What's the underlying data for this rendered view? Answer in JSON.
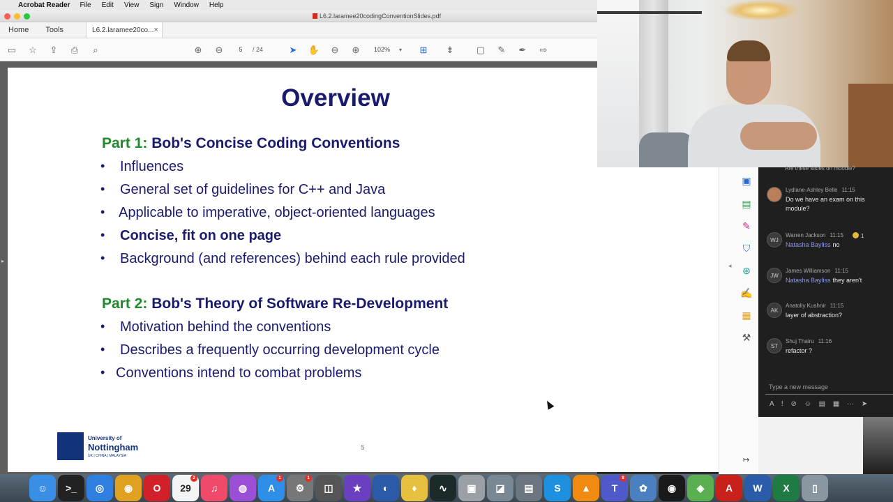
{
  "menubar": {
    "apple": "",
    "app_name": "Acrobat Reader",
    "items": [
      "File",
      "Edit",
      "View",
      "Sign",
      "Window",
      "Help"
    ]
  },
  "window": {
    "title": "L6.2.laramee20codingConventionSlides.pdf"
  },
  "tabs": {
    "home": "Home",
    "tools": "Tools",
    "doc_tab": "L6.2.laramee20co...",
    "close": "×"
  },
  "toolbar": {
    "icons": [
      "save-icon",
      "star-icon",
      "upload-icon",
      "print-icon",
      "zoom-search-icon",
      "page-up-icon",
      "page-down-icon",
      "select-arrow-icon",
      "hand-icon",
      "zoom-out-icon",
      "zoom-in-icon",
      "fit-page-icon",
      "scroll-icon",
      "comment-icon",
      "pen-icon",
      "sign-icon",
      "more-tools-icon"
    ],
    "page_current": "5",
    "page_total": "/ 24",
    "zoom_level": "102%"
  },
  "slide": {
    "title": "Overview",
    "part1": {
      "label": "Part 1:",
      "title": "Bob's Concise Coding Conventions",
      "bullets": [
        "Influences",
        "General set of guidelines for C++ and Java",
        "Applicable to imperative, object-oriented languages",
        "Concise, fit on one page",
        "Background (and references) behind each rule provided"
      ]
    },
    "part2": {
      "label": "Part 2:",
      "title": "Bob's Theory of Software Re-Development",
      "bullets": [
        "Motivation behind the conventions",
        "Describes a frequently occurring development cycle",
        "Conventions intend to combat problems"
      ]
    },
    "bullet_char": "•",
    "page_number": "5",
    "logo": {
      "line1": "University of",
      "line2": "Nottingham",
      "line3": "UK | CHINA | MALAYSIA"
    }
  },
  "chat": {
    "cut_message": "Are these slides on moodle?",
    "messages": [
      {
        "author": "Lydiane-Ashley Belle",
        "time": "11:15",
        "initials": "",
        "mention": "",
        "text": "Do we have an exam on this module?"
      },
      {
        "author": "Warren Jackson",
        "time": "11:15",
        "initials": "WJ",
        "mention": "Natasha Bayliss",
        "text": "no",
        "reaction": "1"
      },
      {
        "author": "James Williamson",
        "time": "11:15",
        "initials": "JW",
        "mention": "Natasha Bayliss",
        "text": "they aren't"
      },
      {
        "author": "Anatoliy Kushnir",
        "time": "11:15",
        "initials": "AK",
        "mention": "",
        "text": "layer of abstraction?"
      },
      {
        "author": "Shuj Thairu",
        "time": "11:16",
        "initials": "ST",
        "mention": "",
        "text": "refactor ?"
      }
    ],
    "compose_placeholder": "Type a new message",
    "compose_tools": "A ! ⊘ ☺ ▤ ▦ ··· ➤"
  },
  "dock": {
    "apps": [
      {
        "name": "finder",
        "glyph": "☺",
        "color": "#3a8ee6"
      },
      {
        "name": "terminal",
        "glyph": ">_",
        "color": "#222222"
      },
      {
        "name": "safari",
        "glyph": "◎",
        "color": "#2f7fe0"
      },
      {
        "name": "chrome",
        "glyph": "◉",
        "color": "#e0a020"
      },
      {
        "name": "opera",
        "glyph": "O",
        "color": "#d0202a"
      },
      {
        "name": "calendar",
        "glyph": "29",
        "color": "#f4f4f4",
        "badge": "2"
      },
      {
        "name": "music",
        "glyph": "♫",
        "color": "#f04a6a"
      },
      {
        "name": "podcasts",
        "glyph": "◍",
        "color": "#9b4fd6"
      },
      {
        "name": "app-store",
        "glyph": "A",
        "color": "#2f8ee8",
        "badge": "1"
      },
      {
        "name": "system-preferences",
        "glyph": "⚙",
        "color": "#777777",
        "badge": "1"
      },
      {
        "name": "screenshot",
        "glyph": "◫",
        "color": "#555555"
      },
      {
        "name": "imovie",
        "glyph": "★",
        "color": "#6a3fc0"
      },
      {
        "name": "network",
        "glyph": "◐",
        "color": "#2a5aa8"
      },
      {
        "name": "cyberduck",
        "glyph": "♦",
        "color": "#e8c040"
      },
      {
        "name": "activity-monitor",
        "glyph": "∿",
        "color": "#1c2a2a"
      },
      {
        "name": "disk-utility",
        "glyph": "▣",
        "color": "#9aa0a6"
      },
      {
        "name": "preview",
        "glyph": "◪",
        "color": "#7a8894"
      },
      {
        "name": "printer",
        "glyph": "▤",
        "color": "#6b7680"
      },
      {
        "name": "skype",
        "glyph": "S",
        "color": "#1e90e0"
      },
      {
        "name": "vlc",
        "glyph": "▲",
        "color": "#f08a10"
      },
      {
        "name": "teams",
        "glyph": "T",
        "color": "#5059c9",
        "badge": "8"
      },
      {
        "name": "photos",
        "glyph": "✿",
        "color": "#4a80c0"
      },
      {
        "name": "obs",
        "glyph": "◉",
        "color": "#1a1a1a"
      },
      {
        "name": "maps",
        "glyph": "◈",
        "color": "#5ab050"
      },
      {
        "name": "acrobat",
        "glyph": "A",
        "color": "#c8201a"
      },
      {
        "name": "word",
        "glyph": "W",
        "color": "#2b5caa"
      },
      {
        "name": "excel",
        "glyph": "X",
        "color": "#1f7a44"
      },
      {
        "name": "trash",
        "glyph": "▯",
        "color": "#8a96a0"
      }
    ]
  },
  "colors": {
    "slide_title": "#1a1a6e",
    "part_label": "#1f8a2a",
    "acrobat_red": "#d12a1e",
    "teams_bg": "#1f1f1f",
    "mention": "#8f97e8"
  }
}
